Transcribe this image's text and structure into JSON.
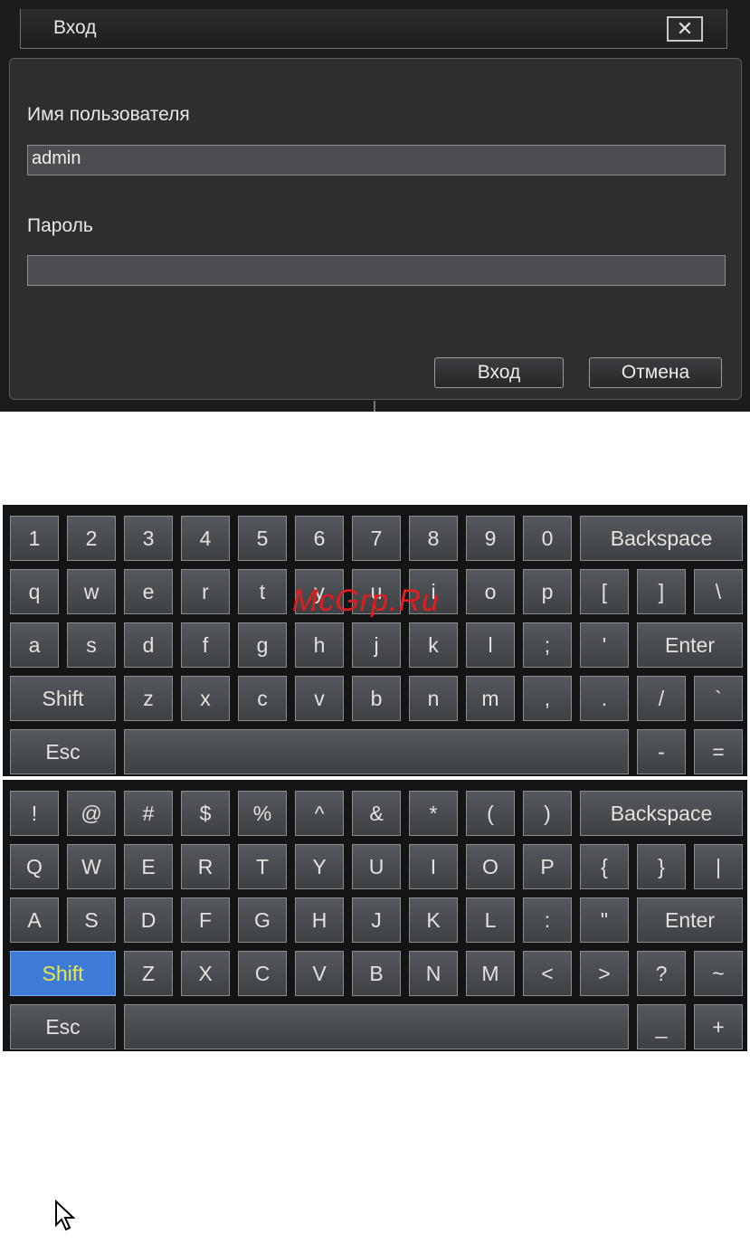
{
  "dialog": {
    "title": "Вход",
    "close_label": "✕",
    "username_label": "Имя пользователя",
    "username_value": "admin",
    "password_label": "Пароль",
    "password_value": "",
    "login_button": "Вход",
    "cancel_button": "Отмена"
  },
  "watermark": "McGrp.Ru",
  "keyboard_lower": {
    "rows": [
      [
        "1",
        "2",
        "3",
        "4",
        "5",
        "6",
        "7",
        "8",
        "9",
        "0",
        "Backspace"
      ],
      [
        "q",
        "w",
        "e",
        "r",
        "t",
        "y",
        "u",
        "i",
        "o",
        "p",
        "[",
        "]",
        "\\"
      ],
      [
        "a",
        "s",
        "d",
        "f",
        "g",
        "h",
        "j",
        "k",
        "l",
        ";",
        "'",
        "Enter"
      ],
      [
        "Shift",
        "z",
        "x",
        "c",
        "v",
        "b",
        "n",
        "m",
        ",",
        ".",
        "/",
        "`"
      ],
      [
        "Esc",
        "",
        "-",
        "="
      ]
    ]
  },
  "keyboard_upper": {
    "active_key": "Shift",
    "rows": [
      [
        "!",
        "@",
        "#",
        "$",
        "%",
        "^",
        "&",
        "*",
        "(",
        ")",
        "Backspace"
      ],
      [
        "Q",
        "W",
        "E",
        "R",
        "T",
        "Y",
        "U",
        "I",
        "O",
        "P",
        "{",
        "}",
        "|"
      ],
      [
        "A",
        "S",
        "D",
        "F",
        "G",
        "H",
        "J",
        "K",
        "L",
        ":",
        "\"",
        "Enter"
      ],
      [
        "Shift",
        "Z",
        "X",
        "C",
        "V",
        "B",
        "N",
        "M",
        "<",
        ">",
        "?",
        "~"
      ],
      [
        "Esc",
        "",
        "_",
        "+"
      ]
    ]
  },
  "icons": {
    "close": "close-icon",
    "cursor": "mouse-pointer-icon"
  }
}
